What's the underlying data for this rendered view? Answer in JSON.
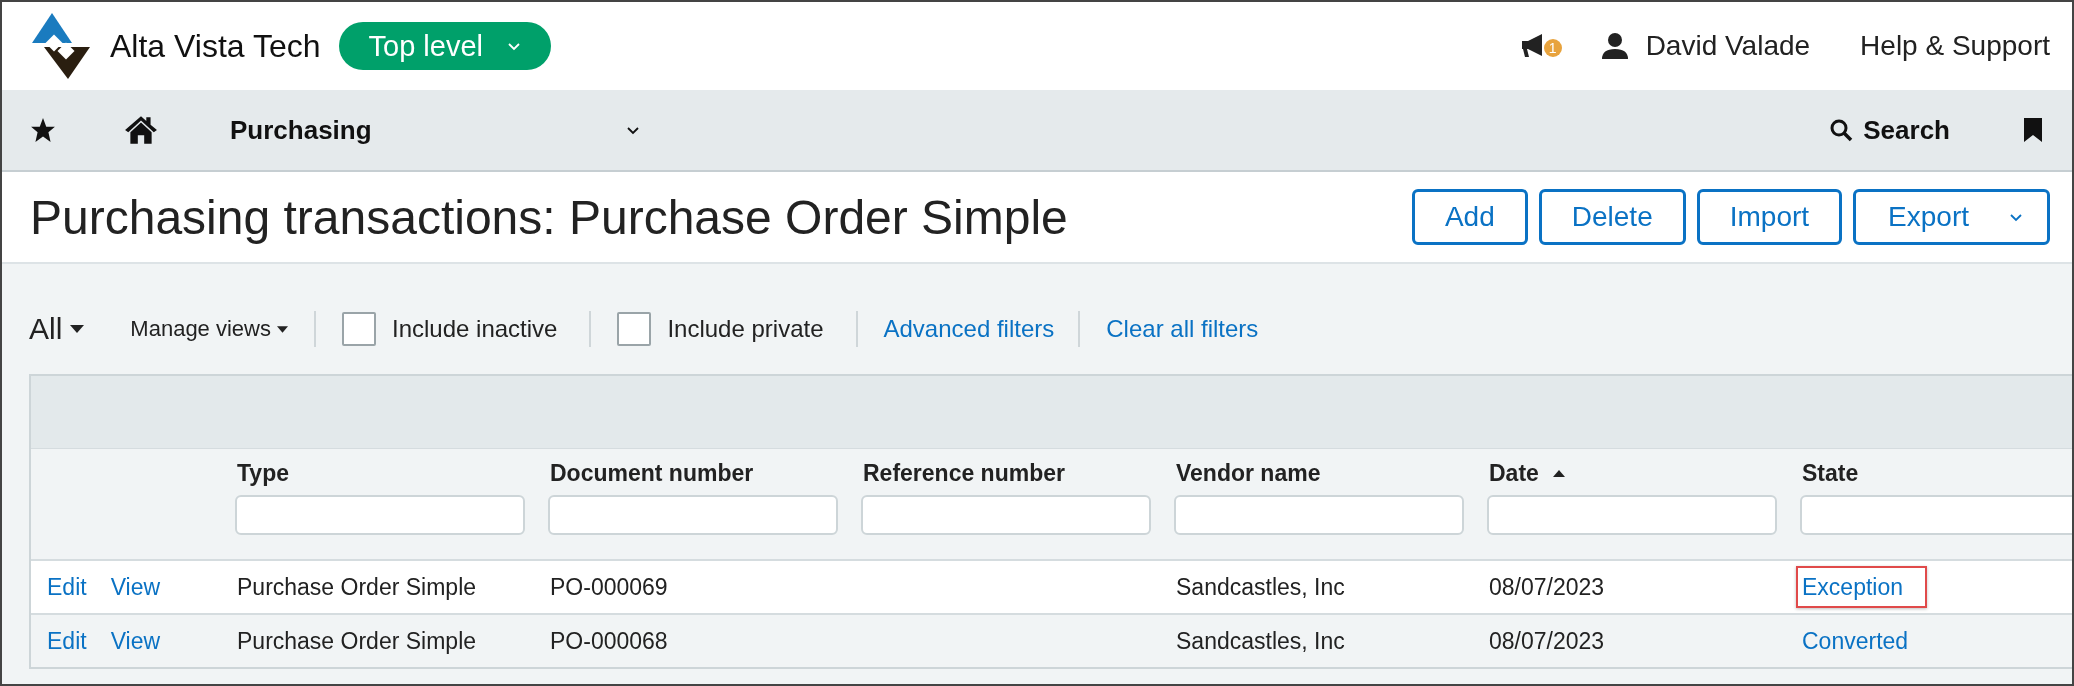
{
  "header": {
    "company": "Alta Vista Tech",
    "entity_button": "Top level",
    "notification_count": "1",
    "user": "David Valade",
    "help": "Help & Support"
  },
  "nav": {
    "module": "Purchasing",
    "search": "Search"
  },
  "page": {
    "title": "Purchasing transactions: Purchase Order Simple",
    "buttons": [
      {
        "label": "Add",
        "kind": "plain"
      },
      {
        "label": "Delete",
        "kind": "plain"
      },
      {
        "label": "Import",
        "kind": "plain"
      },
      {
        "label": "Export",
        "kind": "menu"
      }
    ]
  },
  "filters": {
    "view": "All",
    "manage_views": "Manage views",
    "checkboxes": [
      {
        "label": "Include inactive",
        "checked": false
      },
      {
        "label": "Include private",
        "checked": false
      }
    ],
    "links": [
      "Advanced filters",
      "Clear all filters"
    ]
  },
  "table": {
    "columns": [
      {
        "label": "Type",
        "kind": "text"
      },
      {
        "label": "Document number",
        "kind": "text"
      },
      {
        "label": "Reference number",
        "kind": "text"
      },
      {
        "label": "Vendor name",
        "kind": "text"
      },
      {
        "label": "Date",
        "kind": "text",
        "sorted_ascending": true
      },
      {
        "label": "State",
        "kind": "link"
      }
    ],
    "rows": [
      {
        "actions": [
          "Edit",
          "View"
        ],
        "cells": [
          "Purchase Order Simple",
          "PO-000069",
          null,
          "Sandcastles, Inc",
          "08/07/2023",
          "Exception"
        ],
        "highlighted": true
      },
      {
        "actions": [
          "Edit",
          "View"
        ],
        "cells": [
          "Purchase Order Simple",
          "PO-000068",
          null,
          "Sandcastles, Inc",
          "08/07/2023",
          "Converted"
        ],
        "highlighted": false
      }
    ]
  }
}
